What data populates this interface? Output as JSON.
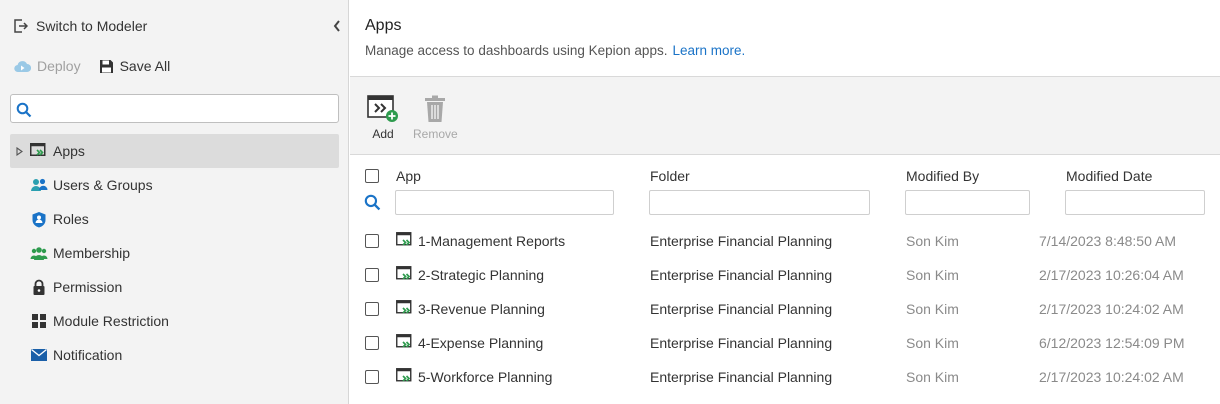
{
  "sidebar": {
    "switch_label": "Switch to Modeler",
    "deploy_label": "Deploy",
    "save_all_label": "Save All",
    "search": {
      "placeholder": "",
      "value": ""
    },
    "items": [
      {
        "label": "Apps",
        "icon": "app-icon",
        "active": true
      },
      {
        "label": "Users & Groups",
        "icon": "users-groups-icon",
        "active": false
      },
      {
        "label": "Roles",
        "icon": "role-shield-icon",
        "active": false
      },
      {
        "label": "Membership",
        "icon": "membership-icon",
        "active": false
      },
      {
        "label": "Permission",
        "icon": "lock-icon",
        "active": false
      },
      {
        "label": "Module Restriction",
        "icon": "grid-icon",
        "active": false
      },
      {
        "label": "Notification",
        "icon": "envelope-icon",
        "active": false
      }
    ]
  },
  "main": {
    "title": "Apps",
    "subtitle": "Manage access to dashboards using Kepion apps.",
    "learn_more": "Learn more.",
    "actions": {
      "add_label": "Add",
      "remove_label": "Remove"
    },
    "columns": {
      "app": "App",
      "folder": "Folder",
      "modified_by": "Modified By",
      "modified_date": "Modified Date"
    },
    "rows": [
      {
        "app": "1-Management Reports",
        "folder": "Enterprise Financial Planning",
        "modified_by": "Son Kim",
        "modified_date": "7/14/2023 8:48:50 AM"
      },
      {
        "app": "2-Strategic Planning",
        "folder": "Enterprise Financial Planning",
        "modified_by": "Son Kim",
        "modified_date": "2/17/2023 10:26:04 AM"
      },
      {
        "app": "3-Revenue Planning",
        "folder": "Enterprise Financial Planning",
        "modified_by": "Son Kim",
        "modified_date": "2/17/2023 10:24:02 AM"
      },
      {
        "app": "4-Expense Planning",
        "folder": "Enterprise Financial Planning",
        "modified_by": "Son Kim",
        "modified_date": "6/12/2023 12:54:09 PM"
      },
      {
        "app": "5-Workforce Planning",
        "folder": "Enterprise Financial Planning",
        "modified_by": "Son Kim",
        "modified_date": "2/17/2023 10:24:02 AM"
      }
    ]
  },
  "colors": {
    "accent_blue": "#1a73c7",
    "green": "#2e9b4e",
    "teal": "#2a9fb0",
    "sidebar_bg": "#f3f3f3"
  }
}
